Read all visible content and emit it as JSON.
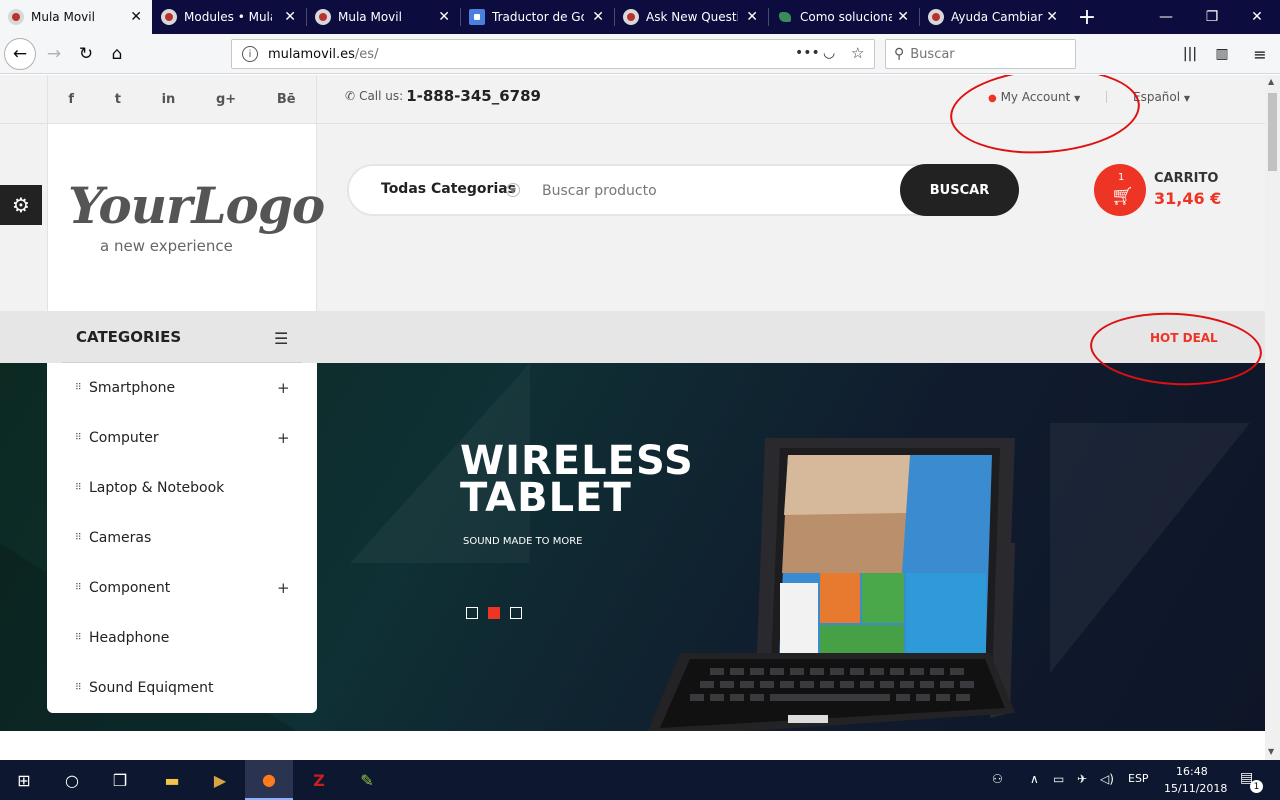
{
  "browser": {
    "tabs": [
      {
        "label": "Mula Movil",
        "active": true
      },
      {
        "label": "Modules • Mula M",
        "active": false
      },
      {
        "label": "Mula Movil",
        "active": false
      },
      {
        "label": "Traductor de Goo",
        "active": false
      },
      {
        "label": "Ask New Questio",
        "active": false
      },
      {
        "label": "Como solucionar",
        "active": false
      },
      {
        "label": "Ayuda Cambiar T",
        "active": false
      }
    ],
    "close_glyph": "✕",
    "new_tab_glyph": "+",
    "url_host": "mulamovil.es",
    "url_path": "/es/",
    "search_placeholder": "Buscar",
    "window_controls": {
      "minimize": "—",
      "maximize": "❐",
      "close": "✕"
    }
  },
  "site": {
    "social": [
      "f",
      "t",
      "in",
      "g+",
      "Bē"
    ],
    "phone_label": "Call us:",
    "phone_number": "1-888-345_6789",
    "account_label": "My Account",
    "language_label": "Español",
    "logo_text": "YourLogo",
    "logo_subtitle": "a new experience",
    "search": {
      "category_label": "Todas Categorias",
      "placeholder": "Buscar producto",
      "button_label": "BUSCAR"
    },
    "cart": {
      "count": "1",
      "label": "CARRITO",
      "total": "31,46 €"
    },
    "categories_title": "CATEGORIES",
    "hot_deal_label": "HOT DEAL",
    "categories": [
      {
        "label": "Smartphone",
        "expandable": true
      },
      {
        "label": "Computer",
        "expandable": true
      },
      {
        "label": "Laptop & Notebook",
        "expandable": false
      },
      {
        "label": "Cameras",
        "expandable": false
      },
      {
        "label": "Component",
        "expandable": true
      },
      {
        "label": "Headphone",
        "expandable": false
      },
      {
        "label": "Sound Equiqment",
        "expandable": false
      }
    ],
    "banner": {
      "title_line1": "WIRELESS",
      "title_line2": "TABLET",
      "subtitle": "SOUND MADE TO MORE",
      "slides": 3,
      "active_slide": 2
    }
  },
  "taskbar": {
    "language": "ESP",
    "time": "16:48",
    "date": "15/11/2018",
    "notification_count": "1"
  },
  "colors": {
    "accent": "#ee3424",
    "tabbar": "#0c0c3f",
    "annotation": "#dd1111"
  }
}
